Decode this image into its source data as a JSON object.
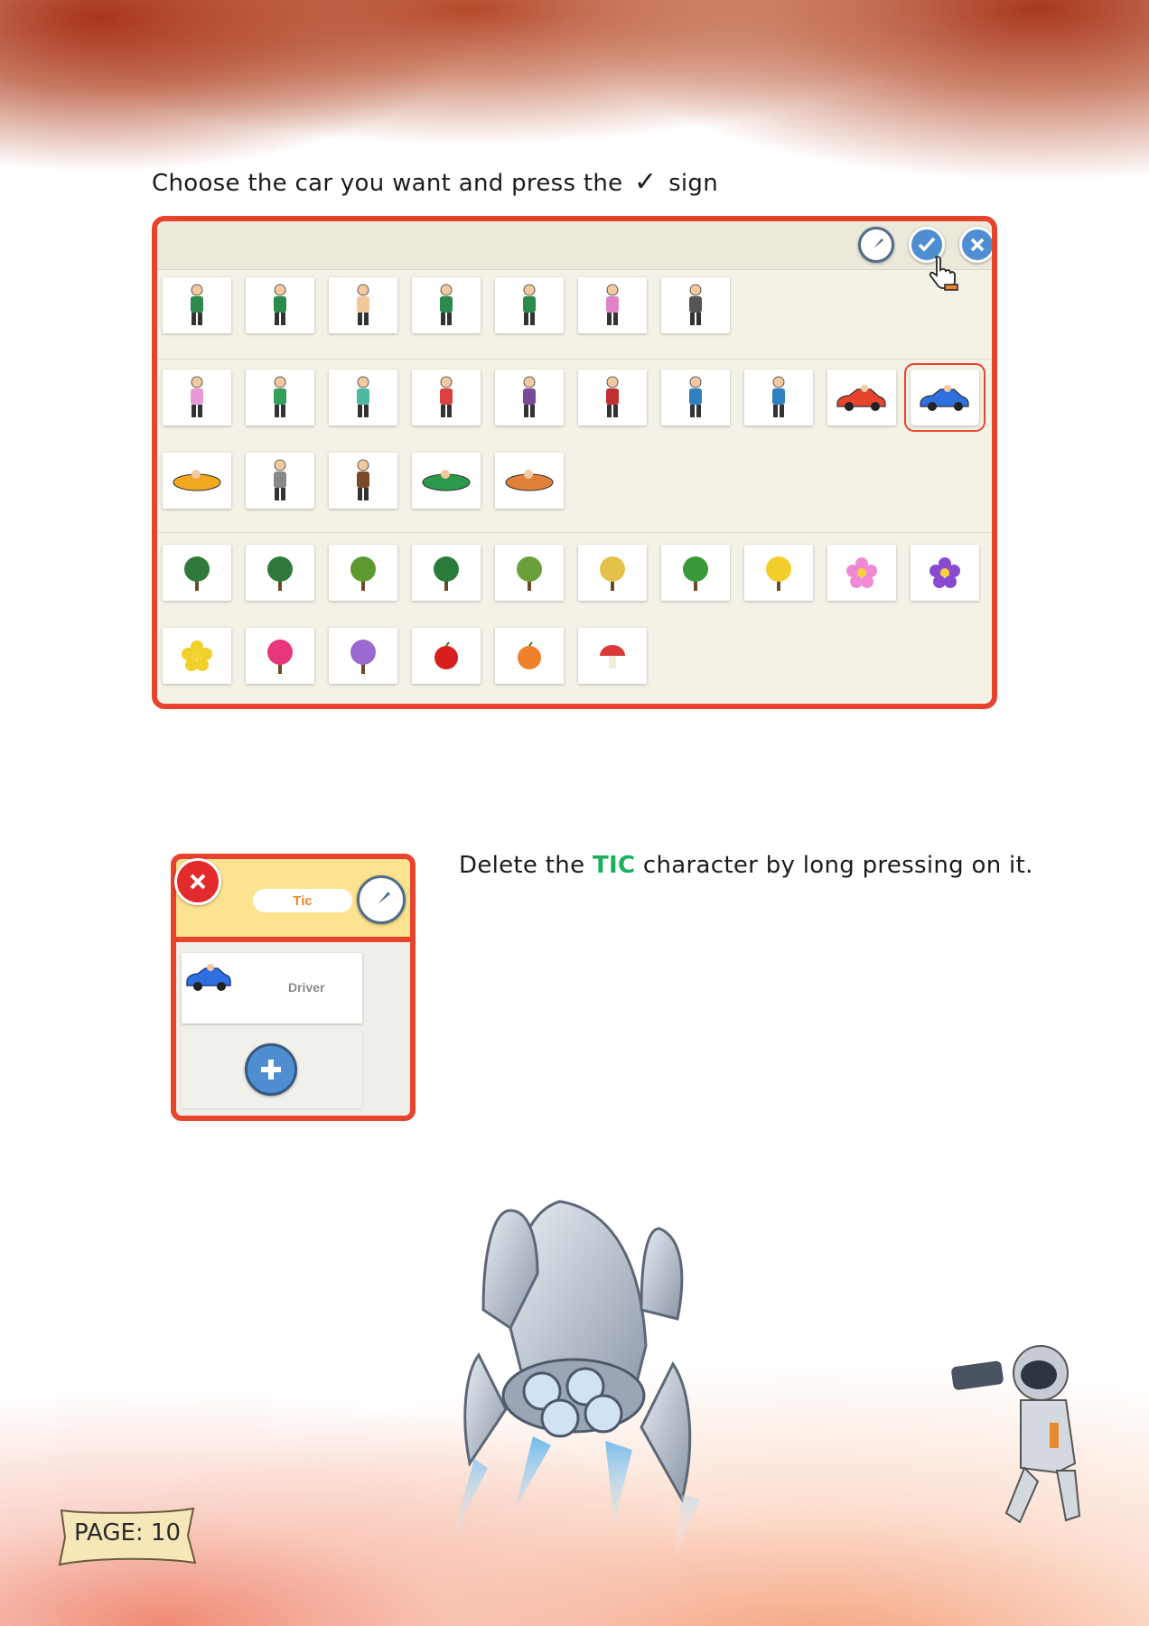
{
  "instructions": {
    "step1_before": "Choose the car you want and press the",
    "step1_check": "✓",
    "step1_after": "sign",
    "step2_before": "Delete the",
    "step2_highlight": "TIC",
    "step2_after": "character by long pressing on it."
  },
  "picker": {
    "toolbar": {
      "paint_icon": "paintbrush-icon",
      "confirm_icon": "check-icon",
      "close_icon": "close-icon"
    },
    "rows": [
      [
        "person",
        "person",
        "baby",
        "person",
        "person",
        "grandma",
        "grandpa"
      ],
      [
        "girl",
        "boy",
        "woman",
        "man",
        "cowgirl",
        "cowboy",
        "cyclist",
        "cyclist",
        "red-car",
        "blue-car"
      ],
      [
        "plane",
        "astronaut",
        "eskimo",
        "diver",
        "boat"
      ],
      [
        "tree",
        "tree",
        "acacia",
        "pine",
        "grass",
        "hay",
        "cactus",
        "daffodil",
        "pink-flower",
        "purple-flower"
      ],
      [
        "yellow-flower",
        "tulip",
        "flower-bush",
        "apple",
        "orange",
        "mushroom"
      ]
    ],
    "selected_item": "blue-car"
  },
  "character_panel": {
    "tic_label": "Tic",
    "driver_label": "Driver",
    "add_icon": "plus-icon",
    "delete_icon": "close-icon"
  },
  "page": {
    "label": "PAGE: 10"
  },
  "colors": {
    "accent": "#e8432c",
    "highlight": "#19b15a",
    "button_blue": "#4f8fd1"
  }
}
